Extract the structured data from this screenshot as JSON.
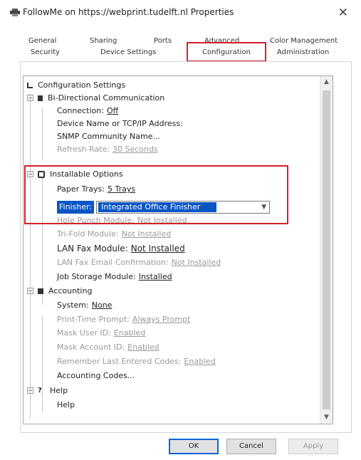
{
  "window": {
    "title": "FollowMe on https://webprint.tudelft.nl Properties"
  },
  "tabs": {
    "row1": [
      "General",
      "Sharing",
      "Ports",
      "Advanced",
      "Color Management"
    ],
    "row2": [
      "Security",
      "Device Settings",
      "Configuration",
      "Administration"
    ],
    "active": "Configuration"
  },
  "tree": {
    "root_label": "Configuration Settings",
    "bidi": {
      "label": "Bi-Directional Communication",
      "items": [
        {
          "label": "Connection:",
          "value": "Off"
        },
        {
          "label": "Device Name or TCP/IP Address:",
          "value": ""
        },
        {
          "label": "SNMP Community Name...",
          "value": ""
        },
        {
          "label": "Refresh Rate:",
          "value": "30 Seconds"
        }
      ]
    },
    "installable": {
      "label": "Installable Options",
      "paper_trays_label": "Paper Trays:",
      "paper_trays_value": "5 Trays",
      "finisher_label": "Finisher:",
      "finisher_value": "Integrated Office Finisher",
      "items": [
        {
          "label": "Hole Punch Module:",
          "value": "Not Installed"
        },
        {
          "label": "Tri-Fold Module:",
          "value": "Not Installed"
        },
        {
          "label": "LAN Fax Module:",
          "value": "Not Installed"
        },
        {
          "label": "LAN Fax Email Confirmation:",
          "value": "Not Installed"
        },
        {
          "label": "Job Storage Module:",
          "value": "Installed"
        }
      ]
    },
    "accounting": {
      "label": "Accounting",
      "items": [
        {
          "label": "System:",
          "value": "None"
        },
        {
          "label": "Print-Time Prompt:",
          "value": "Always Prompt"
        },
        {
          "label": "Mask User ID:",
          "value": "Enabled"
        },
        {
          "label": "Mask Account ID:",
          "value": "Enabled"
        },
        {
          "label": "Remember Last Entered Codes:",
          "value": "Enabled"
        },
        {
          "label": "Accounting Codes...",
          "value": ""
        }
      ]
    },
    "help": {
      "label": "Help",
      "items": [
        {
          "label": "Help",
          "value": ""
        }
      ]
    }
  },
  "buttons": {
    "ok": "OK",
    "cancel": "Cancel",
    "apply": "Apply"
  },
  "colors": {
    "highlight": "#0a55c5",
    "annotation": "#d3202a"
  },
  "icons": [
    "printer-icon",
    "close-icon",
    "scroll-up-icon",
    "scroll-down-icon",
    "dropdown-arrow-icon"
  ]
}
